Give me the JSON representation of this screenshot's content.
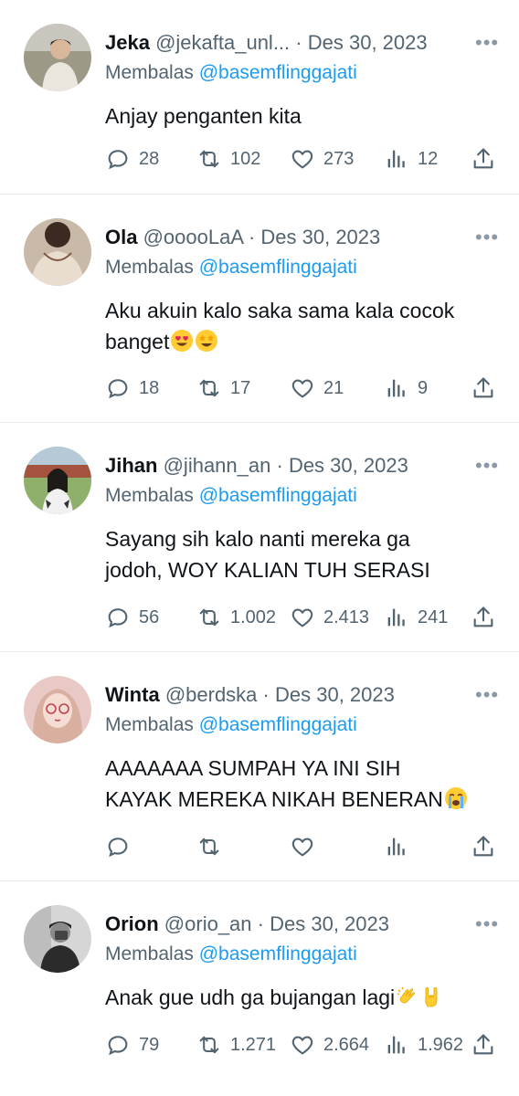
{
  "tweets": [
    {
      "name": "Jeka",
      "handle": "@jekafta_unl...",
      "dot": "·",
      "date": "Des 30, 2023",
      "reply_prefix": "Membalas",
      "reply_to": "@basemflinggajati",
      "text": "Anjay penganten kita",
      "text2": "",
      "emoji": [],
      "replies": "28",
      "retweets": "102",
      "likes": "273",
      "views": "12"
    },
    {
      "name": "Ola",
      "handle": "@ooooLaA",
      "dot": "·",
      "date": "Des 30, 2023",
      "reply_prefix": "Membalas",
      "reply_to": "@basemflinggajati",
      "text": "Aku akuin kalo saka sama kala cocok",
      "text2": "banget",
      "emoji": [
        "heart-eyes-emoji",
        "star-struck-emoji"
      ],
      "replies": "18",
      "retweets": "17",
      "likes": "21",
      "views": "9"
    },
    {
      "name": "Jihan",
      "handle": "@jihann_an",
      "dot": "·",
      "date": "Des 30, 2023",
      "reply_prefix": "Membalas",
      "reply_to": "@basemflinggajati",
      "text": "Sayang sih kalo nanti mereka ga",
      "text2": "jodoh, WOY KALIAN TUH SERASI",
      "emoji": [],
      "replies": "56",
      "retweets": "1.002",
      "likes": "2.413",
      "views": "241"
    },
    {
      "name": "Winta",
      "handle": "@berdska",
      "dot": "·",
      "date": "Des 30, 2023",
      "reply_prefix": "Membalas",
      "reply_to": "@basemflinggajati",
      "text": "AAAAAAA SUMPAH YA INI SIH",
      "text2": "KAYAK MEREKA NIKAH BENERAN",
      "emoji": [
        "crying-emoji"
      ],
      "replies": "",
      "retweets": "",
      "likes": "",
      "views": ""
    },
    {
      "name": "Orion",
      "handle": "@orio_an",
      "dot": "·",
      "date": "Des 30, 2023",
      "reply_prefix": "Membalas",
      "reply_to": "@basemflinggajati",
      "text": "Anak gue udh ga bujangan lagi",
      "text2": "",
      "emoji": [
        "clapping-hands-emoji",
        "rock-on-emoji"
      ],
      "replies": "79",
      "retweets": "1.271",
      "likes": "2.664",
      "views": "1.962"
    }
  ],
  "colors": {
    "text": "#0f1419",
    "secondary": "#536471",
    "mention": "#1d9bf0",
    "divider": "#e6ecf0"
  }
}
